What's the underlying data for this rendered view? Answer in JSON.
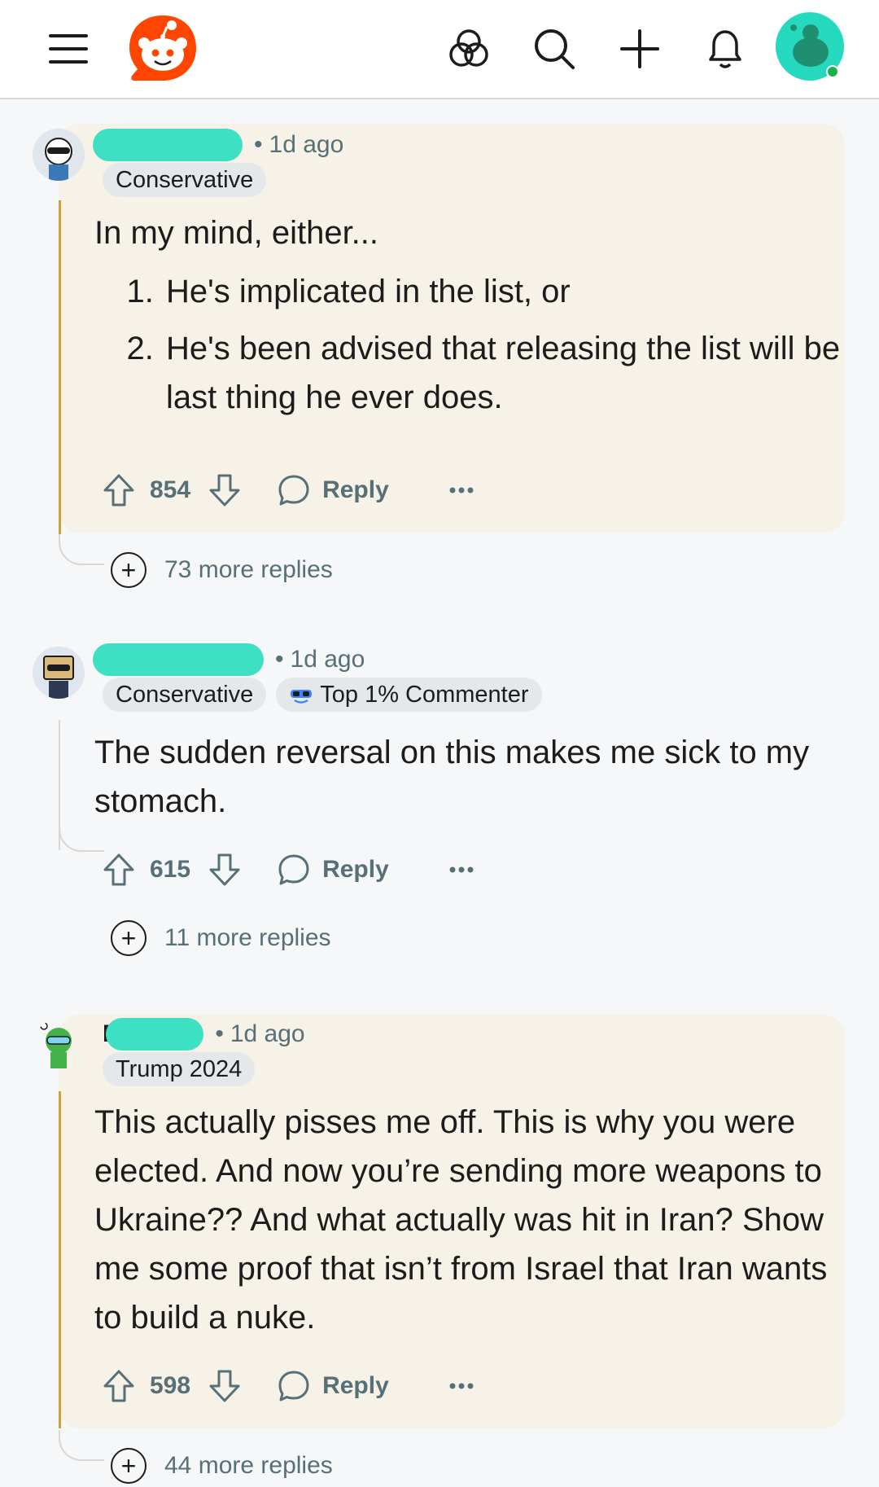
{
  "colors": {
    "accent": "#ff4500",
    "redaction": "#3ee0c4",
    "highlight_bg": "#f7f2e7",
    "thread_gold": "#c9a33b"
  },
  "topbar": {
    "icons": [
      "menu-icon",
      "reddit-logo",
      "communities-icon",
      "search-icon",
      "create-icon",
      "notifications-icon",
      "profile-avatar"
    ]
  },
  "comments": [
    {
      "time": "1d ago",
      "flairs": [
        "Conservative"
      ],
      "intro": "In my mind, either...",
      "list": [
        "He's implicated in the list, or",
        "He's been advised that releasing the list will be last thing he ever does."
      ],
      "score": "854",
      "reply_label": "Reply",
      "more_replies": "73 more replies",
      "highlighted": true
    },
    {
      "time": "1d ago",
      "flairs": [
        "Conservative",
        "Top 1% Commenter"
      ],
      "text": "The sudden reversal on this makes me sick to my stomach.",
      "score": "615",
      "reply_label": "Reply",
      "more_replies": "11 more replies",
      "highlighted": false
    },
    {
      "name_initial": "F",
      "time": "1d ago",
      "flairs": [
        "Trump 2024"
      ],
      "text": "This actually pisses me off. This is why you were elected. And now you’re sending more weapons to Ukraine?? And what actually was hit in Iran? Show me some proof that isn’t from Israel that Iran wants to build a nuke.",
      "score": "598",
      "reply_label": "Reply",
      "more_replies": "44 more replies",
      "highlighted": true
    }
  ]
}
